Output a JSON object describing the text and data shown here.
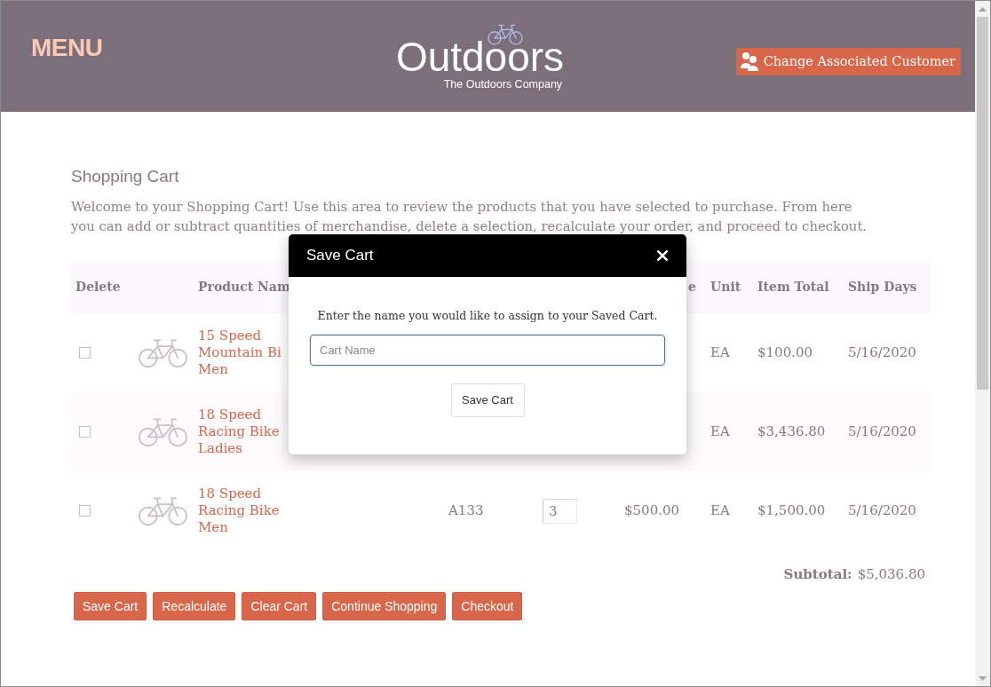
{
  "header": {
    "menu": "MENU",
    "logo": {
      "name": "Outdoors",
      "tagline": "The Outdoors Company"
    },
    "customer_button": "Change Associated Customer"
  },
  "page": {
    "title": "Shopping Cart",
    "intro": "Welcome to your Shopping Cart! Use this area to review the products that you have selected to purchase. From here you can add or subtract quantities of merchandise, delete a selection, recalculate your order, and proceed to checkout."
  },
  "table": {
    "header": {
      "delete": "Delete",
      "product_name": "Product Nam",
      "column_6": "e",
      "unit": "Unit",
      "item_total": "Item Total",
      "ship_days": "Ship Days"
    },
    "rows": [
      {
        "checked": false,
        "product_name": [
          "15 Speed",
          "Mountain Bi",
          "Men"
        ],
        "unit": "EA",
        "item_total": "$100.00",
        "ship_days": "5/16/2020"
      },
      {
        "checked": false,
        "product_name": [
          "18 Speed",
          "Racing Bike",
          "Ladies"
        ],
        "unit": "EA",
        "item_total": "$3,436.80",
        "ship_days": "5/16/2020"
      },
      {
        "checked": false,
        "product_name": [
          "18 Speed",
          "Racing Bike",
          "Men"
        ],
        "column_4": "A133",
        "column_5": "3",
        "column_6": "$500.00",
        "unit": "EA",
        "item_total": "$1,500.00",
        "ship_days": "5/16/2020"
      }
    ]
  },
  "subtotal": {
    "label": "Subtotal:",
    "value": "$5,036.80"
  },
  "buttons": [
    "Save Cart",
    "Recalculate",
    "Clear Cart",
    "Continue Shopping",
    "Checkout"
  ],
  "dialog": {
    "title": "Save Cart",
    "message": "Enter the name you would like to assign to your Saved Cart.",
    "input": {
      "placeholder": "Cart Name",
      "focused": true
    },
    "button": "Save Cart"
  }
}
